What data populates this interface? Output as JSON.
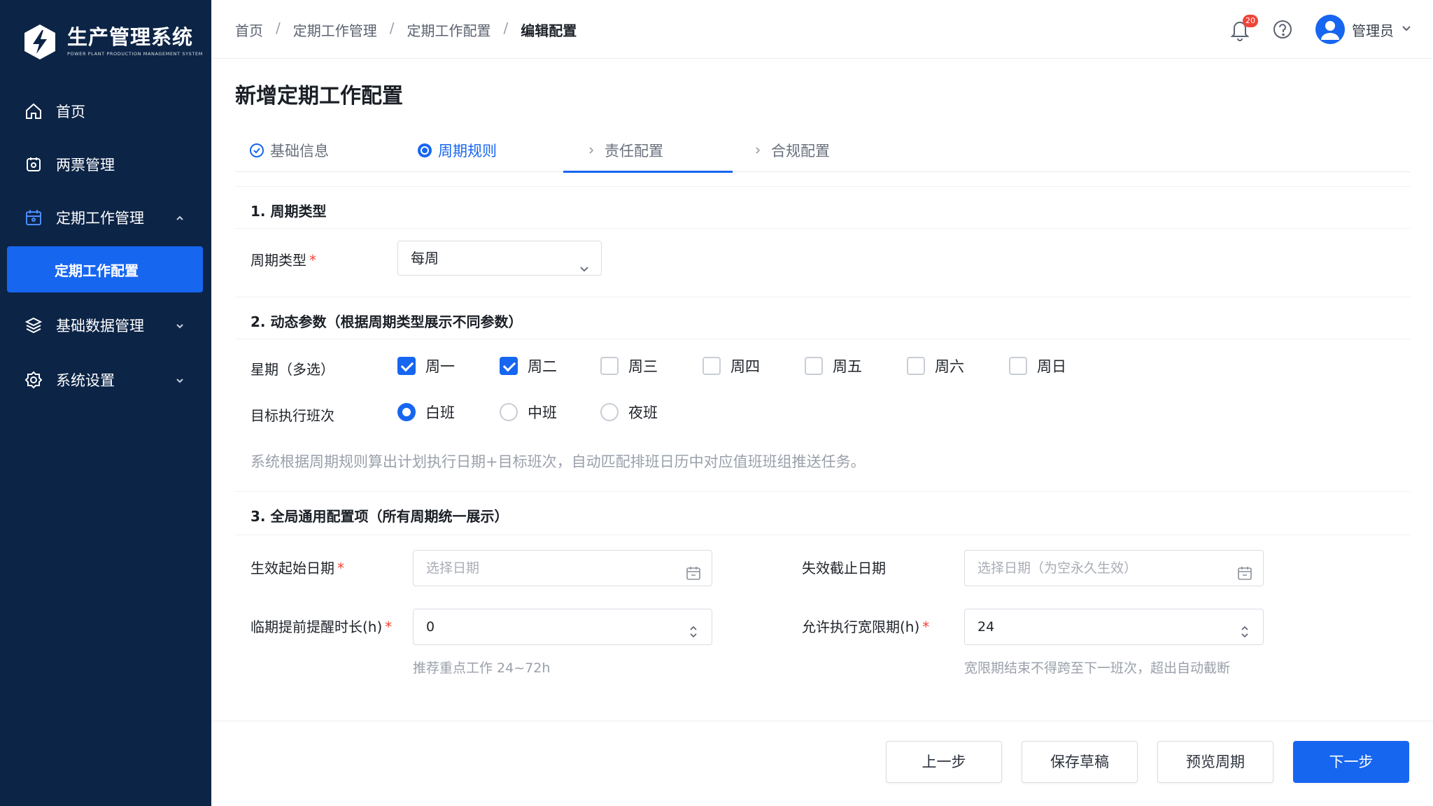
{
  "app": {
    "title": "生产管理系统",
    "subtitle": "POWER PLANT PRODUCTION MANAGEMENT SYSTEM"
  },
  "sidebar": {
    "items": [
      {
        "label": "首页",
        "icon": "home-icon"
      },
      {
        "label": "两票管理",
        "icon": "ticket-icon"
      },
      {
        "label": "定期工作管理",
        "icon": "calendar-icon",
        "expanded": true
      },
      {
        "label": "基础数据管理",
        "icon": "database-icon"
      },
      {
        "label": "系统设置",
        "icon": "gear-icon"
      }
    ],
    "active_sub": "定期工作配置"
  },
  "header": {
    "breadcrumb": [
      "首页",
      "定期工作管理",
      "定期工作配置",
      "编辑配置"
    ],
    "separator": "/",
    "notification_count": "20",
    "user": "管理员"
  },
  "page": {
    "title": "新增定期工作配置",
    "tabs": [
      {
        "label": "基础信息",
        "state": "done"
      },
      {
        "label": "周期规则",
        "state": "active"
      },
      {
        "label": "责任配置",
        "state": "pending"
      },
      {
        "label": "合规配置",
        "state": "pending"
      }
    ]
  },
  "section1": {
    "title": "1. 周期类型",
    "label": "周期类型",
    "required": "*",
    "value": "每周"
  },
  "section2": {
    "title": "2. 动态参数（根据周期类型展示不同参数）",
    "weekday_label": "星期（多选）",
    "weekdays": [
      {
        "label": "周一",
        "checked": true
      },
      {
        "label": "周二",
        "checked": true
      },
      {
        "label": "周三",
        "checked": false
      },
      {
        "label": "周四",
        "checked": false
      },
      {
        "label": "周五",
        "checked": false
      },
      {
        "label": "周六",
        "checked": false
      },
      {
        "label": "周日",
        "checked": false
      }
    ],
    "shift_label": "目标执行班次",
    "shifts": [
      {
        "label": "白班",
        "selected": true
      },
      {
        "label": "中班",
        "selected": false
      },
      {
        "label": "夜班",
        "selected": false
      }
    ],
    "hint": "系统根据周期规则算出计划执行日期+目标班次，自动匹配排班日历中对应值班班组推送任务。"
  },
  "section3": {
    "title": "3. 全局通用配置项（所有周期统一展示）",
    "start_date": {
      "label": "生效起始日期",
      "required": "*",
      "placeholder": "选择日期"
    },
    "end_date": {
      "label": "失效截止日期",
      "placeholder": "选择日期（为空永久生效）"
    },
    "remind": {
      "label": "临期提前提醒时长(h)",
      "required": "*",
      "value": "0",
      "hint": "推荐重点工作 24~72h"
    },
    "grace": {
      "label": "允许执行宽限期(h)",
      "required": "*",
      "value": "24",
      "hint": "宽限期结束不得跨至下一班次，超出自动截断"
    }
  },
  "footer": {
    "prev": "上一步",
    "save": "保存草稿",
    "preview": "预览周期",
    "next": "下一步"
  },
  "colors": {
    "sidebar_bg": "#0c2446",
    "primary": "#1766f0",
    "required": "#f04438"
  }
}
